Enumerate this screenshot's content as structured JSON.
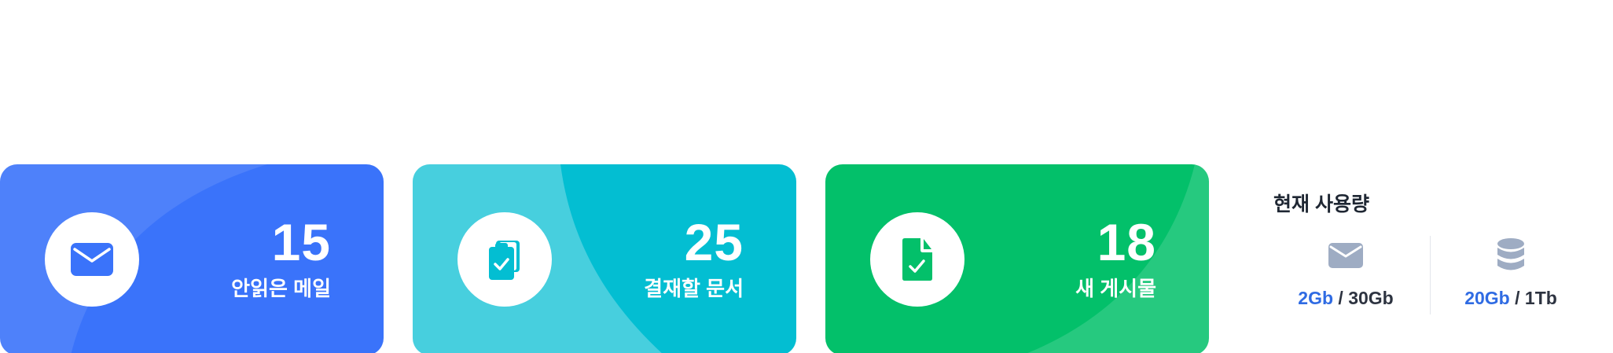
{
  "cards": [
    {
      "count": "15",
      "label": "안읽은 메일",
      "icon": "mail-icon",
      "color": "#3a73fa"
    },
    {
      "count": "25",
      "label": "결재할 문서",
      "icon": "clipboard-check-icon",
      "color": "#03bed2"
    },
    {
      "count": "18",
      "label": "새 게시물",
      "icon": "document-check-icon",
      "color": "#03c06a"
    }
  ],
  "usage": {
    "title": "현재 사용량",
    "mail": {
      "icon": "mail-icon",
      "used": "2Gb",
      "separator": "/",
      "total": "30Gb"
    },
    "storage": {
      "icon": "database-icon",
      "used": "20Gb",
      "separator": "/",
      "total": "1Tb"
    },
    "used_color": "#2f6be3"
  }
}
